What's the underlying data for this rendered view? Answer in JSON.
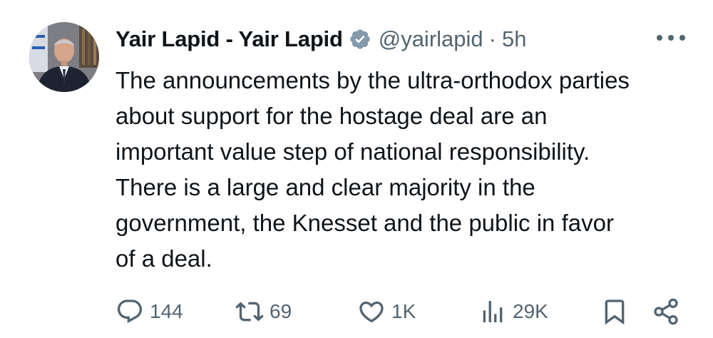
{
  "tweet": {
    "author": {
      "display_name": "Yair Lapid - Yair Lapid",
      "handle": "@yairlapid",
      "separator": "·",
      "time": "5h",
      "verified": true,
      "verified_color": "#829aab"
    },
    "text": "The announcements by the ultra-orthodox parties\nabout support for the hostage deal are an\nimportant value step of national responsibility.\nThere is a large and clear majority in the\ngovernment, the Knesset and the public in favor\nof a deal.",
    "actions": {
      "reply": {
        "icon": "reply-icon",
        "count": "144"
      },
      "retweet": {
        "icon": "retweet-icon",
        "count": "69"
      },
      "like": {
        "icon": "heart-icon",
        "count": "1K"
      },
      "views": {
        "icon": "views-icon",
        "count": "29K"
      },
      "bookmark": {
        "icon": "bookmark-icon"
      },
      "share": {
        "icon": "share-icon"
      }
    },
    "more_icon": "more-icon"
  },
  "colors": {
    "text_primary": "#0f1419",
    "text_secondary": "#536471",
    "icon": "#536471"
  }
}
